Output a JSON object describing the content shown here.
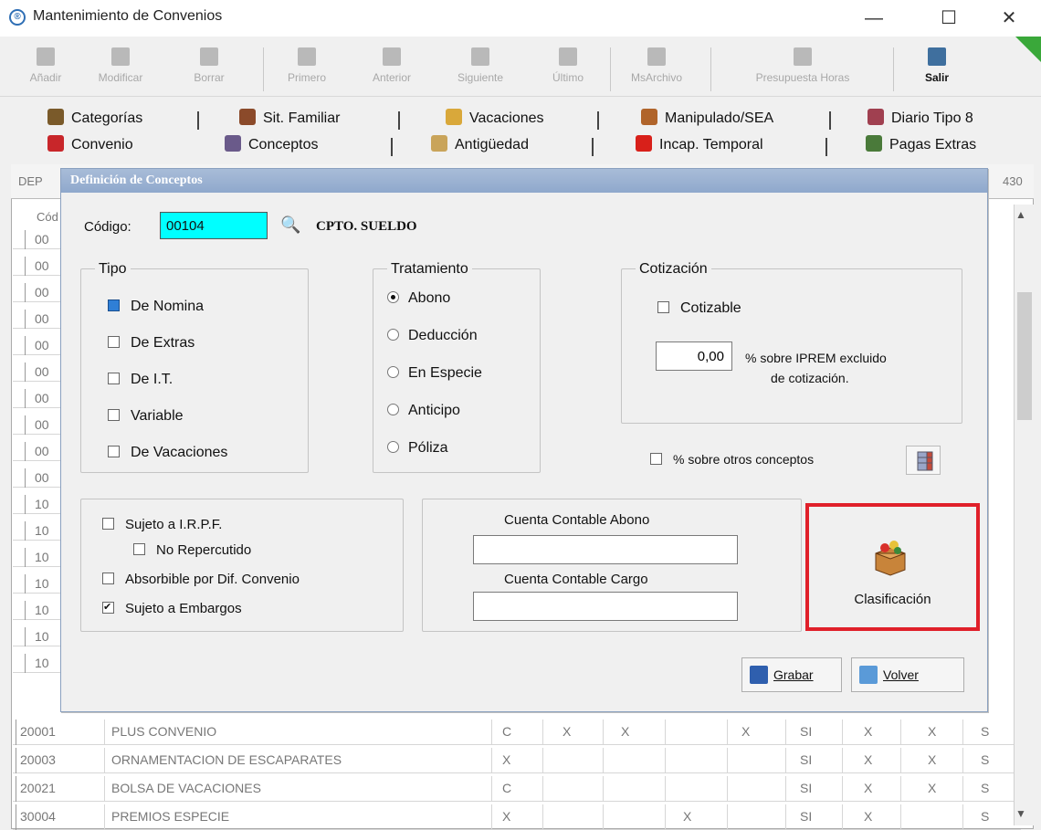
{
  "window": {
    "title": "Mantenimiento de Convenios",
    "controls": [
      "—",
      "☐",
      "✕"
    ]
  },
  "toolbar": {
    "buttons": [
      "Añadir",
      "Modificar",
      "Borrar",
      "Primero",
      "Anterior",
      "Siguiente",
      "Último",
      "MsArchivo",
      "Presupuesta Horas",
      "Salir"
    ]
  },
  "tabs": {
    "row1": [
      "Categorías",
      "Sit. Familiar",
      "Vacaciones",
      "Manipulado/SEA",
      "Diario Tipo 8"
    ],
    "row2": [
      "Convenio",
      "Conceptos",
      "Antigüedad",
      "Incap. Temporal",
      "Pagas Extras"
    ]
  },
  "grid": {
    "dep_label": "DEP",
    "right_value": "430",
    "header_left": "Cód",
    "left_codes": [
      "00",
      "00",
      "00",
      "00",
      "00",
      "00",
      "00",
      "00",
      "00",
      "00",
      "10",
      "10",
      "10",
      "10",
      "10",
      "10",
      "10"
    ],
    "rows": [
      {
        "code": "20001",
        "name": "PLUS CONVENIO",
        "c1": "C",
        "c2": "X",
        "c3": "X",
        "c4": "",
        "c5": "X",
        "c6": "SI",
        "c7": "X",
        "c8": "X",
        "c9": "S"
      },
      {
        "code": "20003",
        "name": "ORNAMENTACION DE ESCAPARATES",
        "c1": "X",
        "c2": "",
        "c3": "",
        "c4": "",
        "c5": "",
        "c6": "SI",
        "c7": "X",
        "c8": "X",
        "c9": "S"
      },
      {
        "code": "20021",
        "name": "BOLSA DE VACACIONES",
        "c1": "C",
        "c2": "",
        "c3": "",
        "c4": "",
        "c5": "",
        "c6": "SI",
        "c7": "X",
        "c8": "X",
        "c9": "S"
      },
      {
        "code": "30004",
        "name": "PREMIOS ESPECIE",
        "c1": "X",
        "c2": "",
        "c3": "",
        "c4": "X",
        "c5": "",
        "c6": "SI",
        "c7": "X",
        "c8": "",
        "c9": "S"
      }
    ]
  },
  "dialog": {
    "title": "Definición de Conceptos",
    "code_label": "Código:",
    "code_value": "00104",
    "concept_name": "CPTO. SUELDO",
    "tipo": {
      "legend": "Tipo",
      "items": [
        {
          "label": "De Nomina",
          "state": "filled"
        },
        {
          "label": "De Extras",
          "state": "off"
        },
        {
          "label": "De I.T.",
          "state": "off"
        },
        {
          "label": "Variable",
          "state": "off"
        },
        {
          "label": "De Vacaciones",
          "state": "off"
        }
      ]
    },
    "tratamiento": {
      "legend": "Tratamiento",
      "options": [
        "Abono",
        "Deducción",
        "En Especie",
        "Anticipo",
        "Póliza"
      ],
      "selected": "Abono"
    },
    "cotizacion": {
      "legend": "Cotización",
      "cotizable_label": "Cotizable",
      "pct_value": "0,00",
      "pct_label_1": "% sobre IPREM excluido",
      "pct_label_2": "de cotización."
    },
    "otros_label": "% sobre otros conceptos",
    "flags": [
      {
        "label": "Sujeto a I.R.P.F.",
        "checked": false
      },
      {
        "label": "No Repercutido",
        "checked": false
      },
      {
        "label": "Absorbible por Dif. Convenio",
        "checked": false
      },
      {
        "label": "Sujeto a Embargos",
        "checked": true
      }
    ],
    "cuenta_abono_label": "Cuenta Contable Abono",
    "cuenta_abono_value": "",
    "cuenta_cargo_label": "Cuenta Contable Cargo",
    "cuenta_cargo_value": "",
    "clasificacion_label": "Clasificación",
    "grabar_label": "Grabar",
    "volver_label": "Volver"
  },
  "colors": {
    "code_field_bg": "#00ffff",
    "highlight_border": "#e0202a",
    "dialog_title_bg": "#8fa8cc"
  }
}
